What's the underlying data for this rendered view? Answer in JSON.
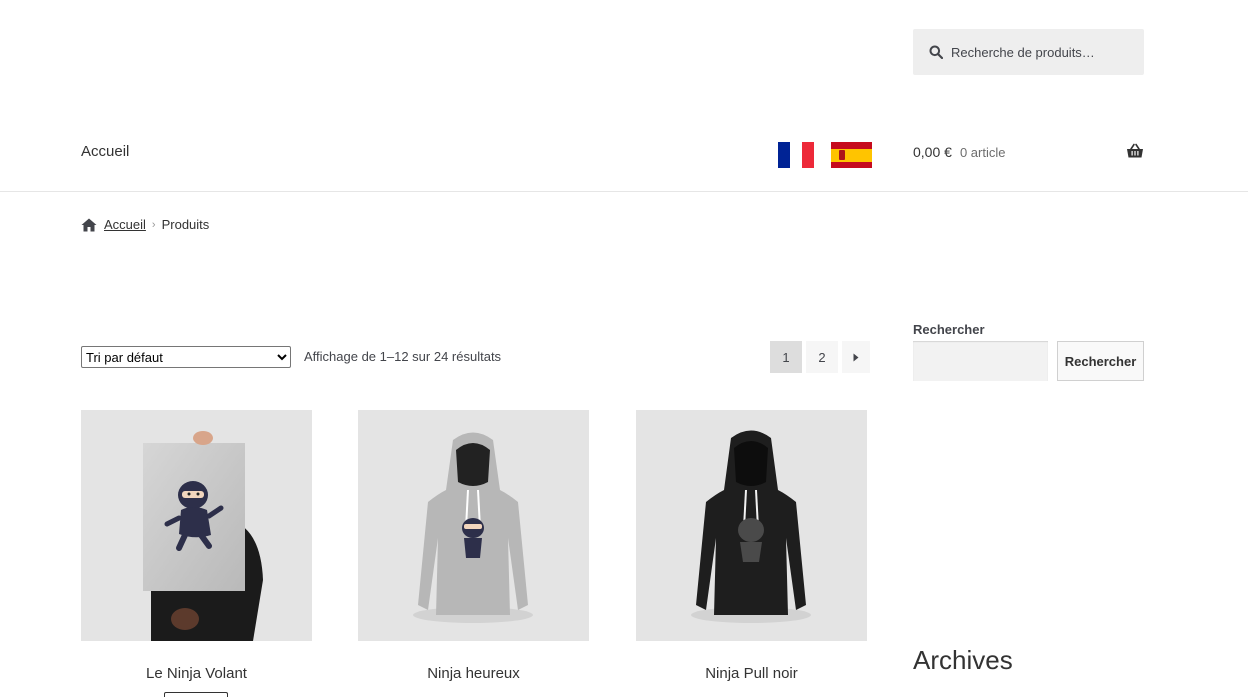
{
  "header": {
    "search_placeholder": "Recherche de produits…",
    "nav_home": "Accueil",
    "cart_amount": "0,00 €",
    "cart_count": "0 article",
    "colors": {
      "fr_blue": "#002395",
      "fr_white": "#ffffff",
      "fr_red": "#ed2939",
      "es_red": "#c60b1e",
      "es_yellow": "#ffc400"
    }
  },
  "breadcrumb": {
    "home": "Accueil",
    "current": "Produits"
  },
  "toolbar": {
    "sort_selected": "Tri par défaut",
    "result_count": "Affichage de 1–12 sur 24 résultats",
    "pages": [
      "1",
      "2"
    ],
    "current_page": "1",
    "next_icon": "chevron-right-icon"
  },
  "products": [
    {
      "title": "Le Ninja Volant",
      "image": "poster-ninja"
    },
    {
      "title": "Ninja heureux",
      "image": "grey-hoodie"
    },
    {
      "title": "Ninja Pull noir",
      "image": "black-hoodie"
    }
  ],
  "sidebar": {
    "search_title": "Rechercher",
    "search_button": "Rechercher",
    "archives_title": "Archives"
  }
}
